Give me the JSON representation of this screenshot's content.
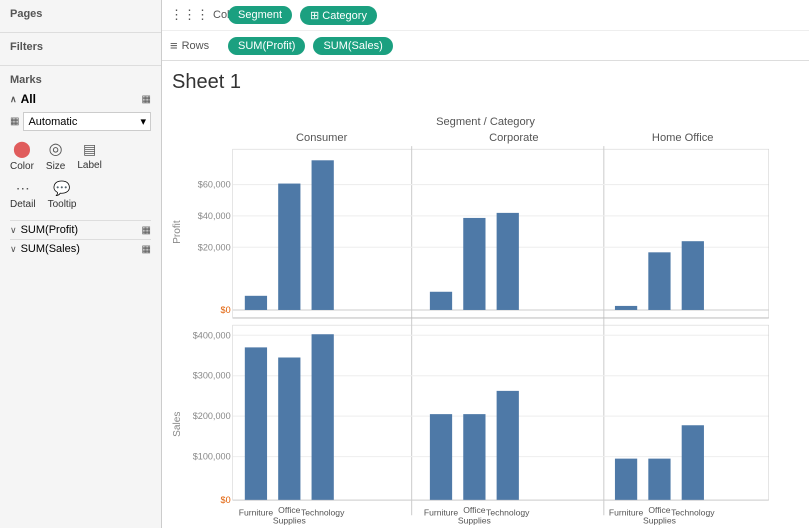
{
  "sidebar": {
    "pages_label": "Pages",
    "filters_label": "Filters",
    "marks_label": "Marks",
    "marks_all": "All",
    "marks_dropdown": "Automatic",
    "marks_color": "Color",
    "marks_size": "Size",
    "marks_label_btn": "Label",
    "marks_detail": "Detail",
    "marks_tooltip": "Tooltip",
    "sum_profit": "SUM(Profit)",
    "sum_sales": "SUM(Sales)"
  },
  "toolbar": {
    "columns_label": "Columns",
    "rows_label": "Rows",
    "segment_pill": "Segment",
    "category_pill": "⊞ Category",
    "profit_pill": "SUM(Profit)",
    "sales_pill": "SUM(Sales)"
  },
  "sheet": {
    "title": "Sheet 1",
    "legend_title": "Segment / Category",
    "segments": [
      "Consumer",
      "Corporate",
      "Home Office"
    ],
    "categories": [
      "Furniture",
      "Office Supplies",
      "Technology"
    ],
    "profit_axis_label": "Profit",
    "sales_axis_label": "Sales",
    "profit_ticks": [
      "$60,000",
      "$40,000",
      "$20,000",
      "$0"
    ],
    "sales_ticks": [
      "$400,000",
      "$300,000",
      "$200,000",
      "$100,000",
      "$0"
    ],
    "bar_color": "#4e79a7"
  }
}
